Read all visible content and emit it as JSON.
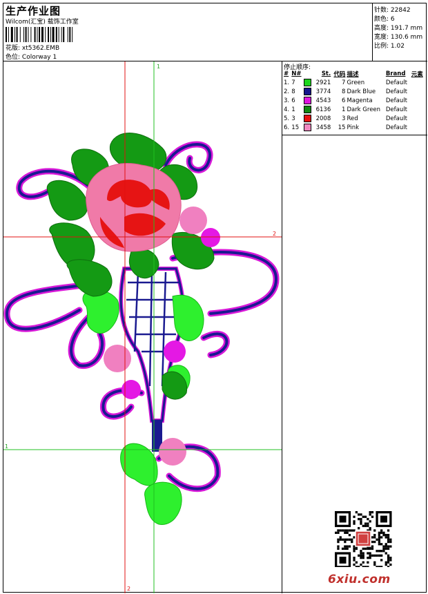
{
  "header": {
    "title": "生产作业图",
    "studio": "Wilcom(汇宝) 载饰工作室",
    "design_label": "花版:",
    "design_value": "xt5362.EMB",
    "colorway_label": "色位:",
    "colorway_value": "Colorway 1"
  },
  "stats": [
    {
      "label": "针数:",
      "value": "22842"
    },
    {
      "label": "颜色:",
      "value": "6"
    },
    {
      "label": "高度:",
      "value": "191.7 mm"
    },
    {
      "label": "宽度:",
      "value": "130.6 mm"
    },
    {
      "label": "比例:",
      "value": "1.02"
    }
  ],
  "guides": {
    "v1": "1",
    "h2": "2",
    "h1": "1",
    "v2": "2"
  },
  "stop_sequence": {
    "title": "停止顺序:",
    "columns": [
      "#",
      "N#",
      "St.",
      "代码",
      "描述",
      "Brand",
      "元素"
    ],
    "rows": [
      {
        "num": "1.",
        "needle": "7",
        "color": "#1ed61e",
        "stitches": "2921",
        "code": "7",
        "desc": "Green",
        "brand": "Default"
      },
      {
        "num": "2.",
        "needle": "8",
        "color": "#16168c",
        "stitches": "3774",
        "code": "8",
        "desc": "Dark Blue",
        "brand": "Default"
      },
      {
        "num": "3.",
        "needle": "6",
        "color": "#e014e0",
        "stitches": "4543",
        "code": "6",
        "desc": "Magenta",
        "brand": "Default"
      },
      {
        "num": "4.",
        "needle": "1",
        "color": "#128a12",
        "stitches": "6136",
        "code": "1",
        "desc": "Dark Green",
        "brand": "Default"
      },
      {
        "num": "5.",
        "needle": "3",
        "color": "#e81010",
        "stitches": "2008",
        "code": "3",
        "desc": "Red",
        "brand": "Default"
      },
      {
        "num": "6.",
        "needle": "15",
        "color": "#f088c0",
        "stitches": "3458",
        "code": "15",
        "desc": "Pink",
        "brand": "Default"
      }
    ]
  },
  "watermark": "6xiu.com"
}
